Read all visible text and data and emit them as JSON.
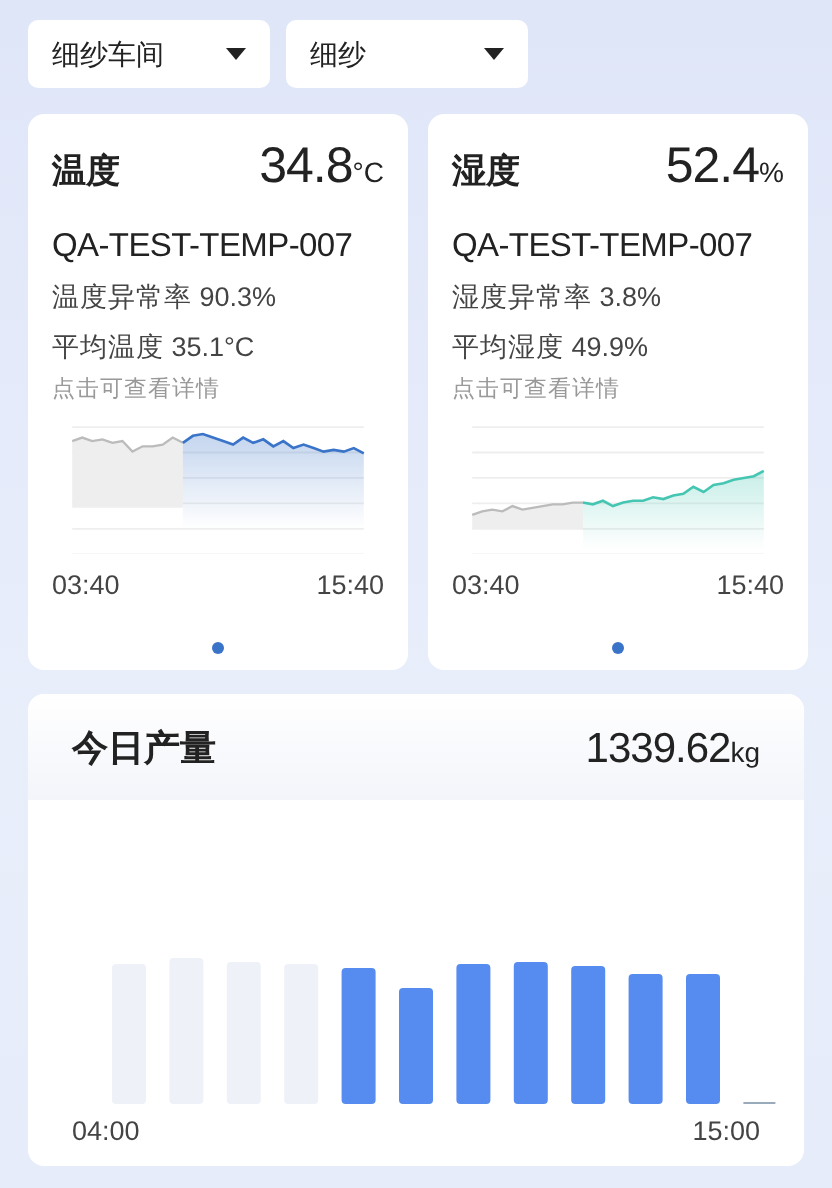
{
  "filters": [
    {
      "value": "细纱车间"
    },
    {
      "value": "细纱"
    }
  ],
  "sensor_cards": [
    {
      "title": "温度",
      "value": "34.8",
      "unit": "°C",
      "device": "QA-TEST-TEMP-007",
      "stats": [
        "温度异常率 90.3%",
        "平均温度 35.1°C"
      ],
      "hint": "点击可查看详情",
      "color": "#3a74c9",
      "time_start": "03:40",
      "time_end": "15:40"
    },
    {
      "title": "湿度",
      "value": "52.4",
      "unit": "%",
      "device": "QA-TEST-TEMP-007",
      "stats": [
        "湿度异常率 3.8%",
        "平均湿度 49.9%"
      ],
      "hint": "点击可查看详情",
      "color": "#45c6b2",
      "time_start": "03:40",
      "time_end": "15:40"
    }
  ],
  "production": {
    "title": "今日产量",
    "value": "1339.62",
    "unit": "kg",
    "time_start": "04:00",
    "time_end": "15:00"
  }
}
